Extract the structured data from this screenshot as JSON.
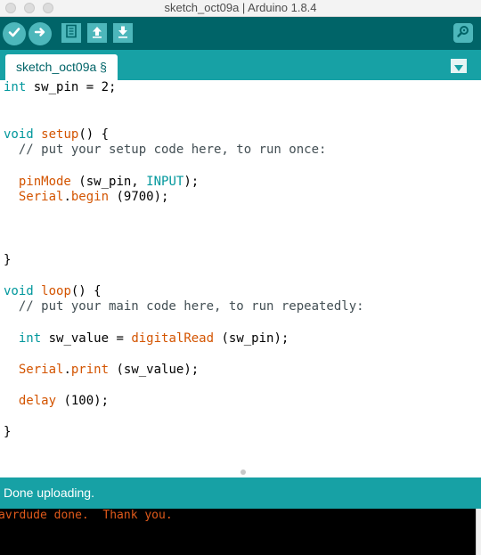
{
  "window": {
    "title": "sketch_oct09a | Arduino 1.8.4"
  },
  "toolbar": {
    "verify_icon": "checkmark-icon",
    "upload_icon": "arrow-right-icon",
    "new_icon": "new-document-icon",
    "open_icon": "arrow-up-icon",
    "save_icon": "arrow-down-icon",
    "serial_icon": "magnifier-icon"
  },
  "tabs": [
    {
      "label": "sketch_oct09a §"
    }
  ],
  "editor": {
    "lines": [
      [
        {
          "t": "int",
          "c": "kw"
        },
        {
          "t": " sw_pin = 2;",
          "c": ""
        }
      ],
      [],
      [],
      [
        {
          "t": "void",
          "c": "kw"
        },
        {
          "t": " ",
          "c": ""
        },
        {
          "t": "setup",
          "c": "fn"
        },
        {
          "t": "() {",
          "c": ""
        }
      ],
      [
        {
          "t": "  // put your setup code here, to run once:",
          "c": "cm"
        }
      ],
      [],
      [
        {
          "t": "  ",
          "c": ""
        },
        {
          "t": "pinMode",
          "c": "fn"
        },
        {
          "t": " (sw_pin, ",
          "c": ""
        },
        {
          "t": "INPUT",
          "c": "kw"
        },
        {
          "t": ");",
          "c": ""
        }
      ],
      [
        {
          "t": "  ",
          "c": ""
        },
        {
          "t": "Serial",
          "c": "fn"
        },
        {
          "t": ".",
          "c": ""
        },
        {
          "t": "begin",
          "c": "fn"
        },
        {
          "t": " (9700);",
          "c": ""
        }
      ],
      [],
      [],
      [],
      [
        {
          "t": "}",
          "c": ""
        }
      ],
      [],
      [
        {
          "t": "void",
          "c": "kw"
        },
        {
          "t": " ",
          "c": ""
        },
        {
          "t": "loop",
          "c": "fn"
        },
        {
          "t": "() {",
          "c": ""
        }
      ],
      [
        {
          "t": "  // put your main code here, to run repeatedly:",
          "c": "cm"
        }
      ],
      [],
      [
        {
          "t": "  ",
          "c": ""
        },
        {
          "t": "int",
          "c": "kw"
        },
        {
          "t": " sw_value = ",
          "c": ""
        },
        {
          "t": "digitalRead",
          "c": "fn"
        },
        {
          "t": " (sw_pin);",
          "c": ""
        }
      ],
      [],
      [
        {
          "t": "  ",
          "c": ""
        },
        {
          "t": "Serial",
          "c": "fn"
        },
        {
          "t": ".",
          "c": ""
        },
        {
          "t": "print",
          "c": "fn"
        },
        {
          "t": " (sw_value);",
          "c": ""
        }
      ],
      [],
      [
        {
          "t": "  ",
          "c": ""
        },
        {
          "t": "delay",
          "c": "fn"
        },
        {
          "t": " (100);",
          "c": ""
        }
      ],
      [],
      [
        {
          "t": "}",
          "c": ""
        }
      ]
    ]
  },
  "status": {
    "message": "Done uploading."
  },
  "console": {
    "output": "avrdude done.  Thank you."
  },
  "colors": {
    "toolbar_bg": "#006468",
    "tab_row_bg": "#17a1a5",
    "button_bg": "#4db7bb",
    "keyword": "#00979c",
    "function": "#d35400",
    "comment": "#434f54",
    "console_text": "#e05a1b"
  }
}
